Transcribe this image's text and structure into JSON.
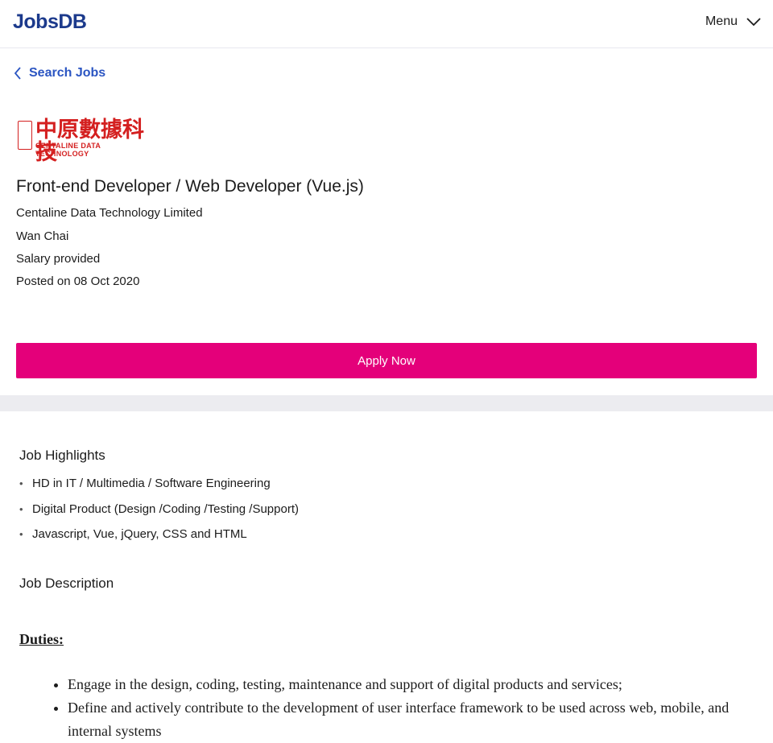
{
  "header": {
    "logo": "JobsDB",
    "menu_label": "Menu"
  },
  "nav": {
    "back_label": "Search Jobs"
  },
  "company_logo": {
    "chinese_text": "中原數據科技",
    "english_text": "CENTALINE DATA TECHNOLOGY"
  },
  "job": {
    "title": "Front-end Developer / Web Developer (Vue.js)",
    "company": "Centaline Data Technology Limited",
    "location": "Wan Chai",
    "salary": "Salary provided",
    "posted": "Posted on 08 Oct 2020"
  },
  "apply_label": "Apply Now",
  "highlights": {
    "title": "Job Highlights",
    "items": [
      "HD in IT / Multimedia / Software Engineering",
      "Digital Product (Design /Coding /Testing /Support)",
      "Javascript, Vue, jQuery, CSS and HTML"
    ]
  },
  "description": {
    "title": "Job Description",
    "duties_heading": "Duties:",
    "duties": [
      "Engage in the design, coding, testing, maintenance and support of digital products and services;",
      "Define and actively contribute to the development of user interface framework to be used across web, mobile, and internal systems"
    ]
  },
  "colors": {
    "brand_blue": "#1c3a8c",
    "link_blue": "#2b55c2",
    "apply_pink": "#e4007a",
    "logo_red": "#d42020"
  }
}
